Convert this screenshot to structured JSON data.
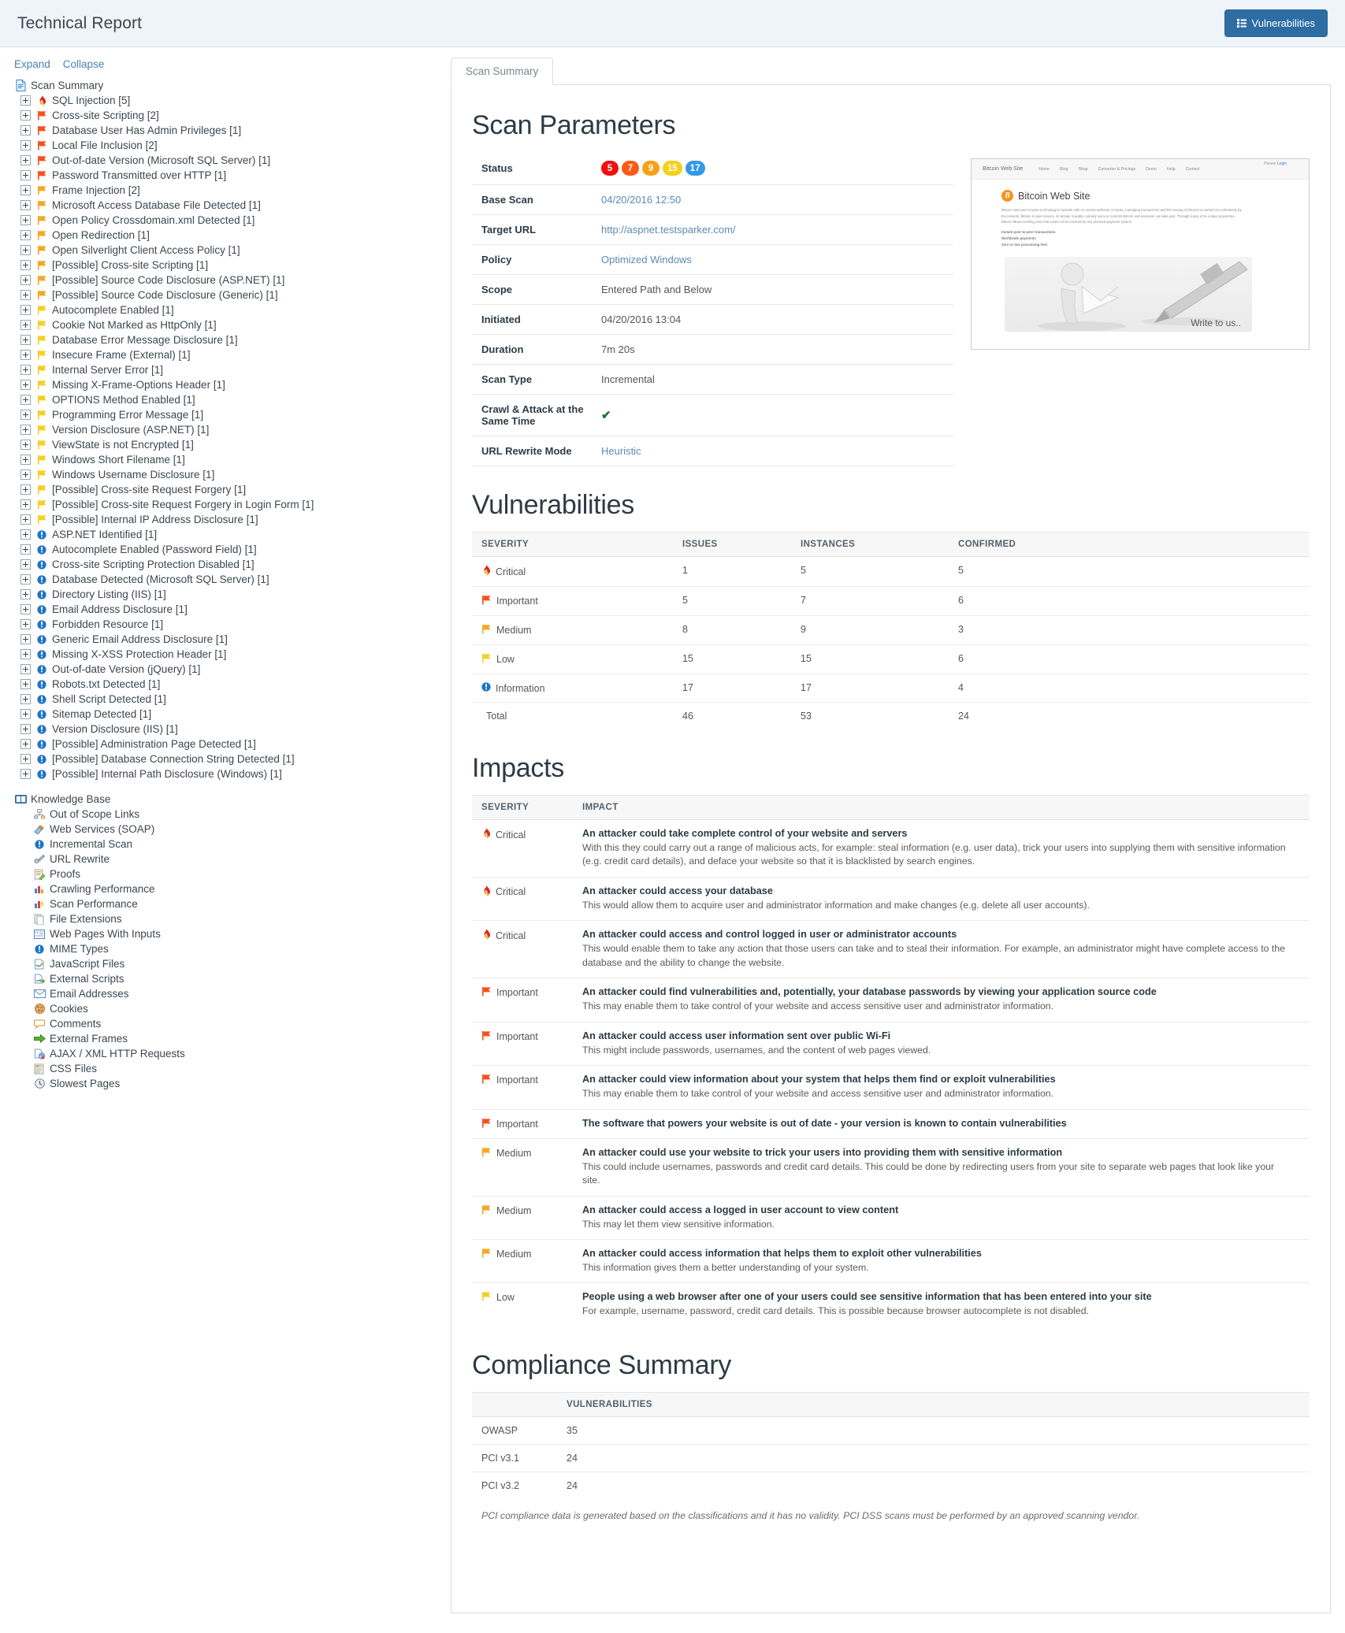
{
  "header": {
    "title": "Technical Report",
    "vulnerabilities_button": "Vulnerabilities"
  },
  "sidebar": {
    "expand_label": "Expand",
    "collapse_label": "Collapse",
    "root_label": "Scan Summary",
    "root_icon": "document-icon",
    "items": [
      {
        "label": "SQL Injection [5]",
        "icon": "fire-icon",
        "sev": "critical"
      },
      {
        "label": "Cross-site Scripting [2]",
        "icon": "flag-icon",
        "sev": "important"
      },
      {
        "label": "Database User Has Admin Privileges [1]",
        "icon": "flag-icon",
        "sev": "important"
      },
      {
        "label": "Local File Inclusion [2]",
        "icon": "flag-icon",
        "sev": "important"
      },
      {
        "label": "Out-of-date Version (Microsoft SQL Server) [1]",
        "icon": "flag-icon",
        "sev": "important"
      },
      {
        "label": "Password Transmitted over HTTP [1]",
        "icon": "flag-icon",
        "sev": "important"
      },
      {
        "label": "Frame Injection [2]",
        "icon": "flag-icon",
        "sev": "medium"
      },
      {
        "label": "Microsoft Access Database File Detected [1]",
        "icon": "flag-icon",
        "sev": "medium"
      },
      {
        "label": "Open Policy Crossdomain.xml Detected [1]",
        "icon": "flag-icon",
        "sev": "medium"
      },
      {
        "label": "Open Redirection [1]",
        "icon": "flag-icon",
        "sev": "medium"
      },
      {
        "label": "Open Silverlight Client Access Policy [1]",
        "icon": "flag-icon",
        "sev": "medium"
      },
      {
        "label": "[Possible] Cross-site Scripting [1]",
        "icon": "flag-icon",
        "sev": "medium"
      },
      {
        "label": "[Possible] Source Code Disclosure (ASP.NET) [1]",
        "icon": "flag-icon",
        "sev": "medium"
      },
      {
        "label": "[Possible] Source Code Disclosure (Generic) [1]",
        "icon": "flag-icon",
        "sev": "medium"
      },
      {
        "label": "Autocomplete Enabled [1]",
        "icon": "flag-icon",
        "sev": "low"
      },
      {
        "label": "Cookie Not Marked as HttpOnly [1]",
        "icon": "flag-icon",
        "sev": "low"
      },
      {
        "label": "Database Error Message Disclosure [1]",
        "icon": "flag-icon",
        "sev": "low"
      },
      {
        "label": "Insecure Frame (External) [1]",
        "icon": "flag-icon",
        "sev": "low"
      },
      {
        "label": "Internal Server Error [1]",
        "icon": "flag-icon",
        "sev": "low"
      },
      {
        "label": "Missing X-Frame-Options Header [1]",
        "icon": "flag-icon",
        "sev": "low"
      },
      {
        "label": "OPTIONS Method Enabled [1]",
        "icon": "flag-icon",
        "sev": "low"
      },
      {
        "label": "Programming Error Message [1]",
        "icon": "flag-icon",
        "sev": "low"
      },
      {
        "label": "Version Disclosure (ASP.NET) [1]",
        "icon": "flag-icon",
        "sev": "low"
      },
      {
        "label": "ViewState is not Encrypted [1]",
        "icon": "flag-icon",
        "sev": "low"
      },
      {
        "label": "Windows Short Filename [1]",
        "icon": "flag-icon",
        "sev": "low"
      },
      {
        "label": "Windows Username Disclosure [1]",
        "icon": "flag-icon",
        "sev": "low"
      },
      {
        "label": "[Possible] Cross-site Request Forgery [1]",
        "icon": "flag-icon",
        "sev": "low"
      },
      {
        "label": "[Possible] Cross-site Request Forgery in Login Form [1]",
        "icon": "flag-icon",
        "sev": "low"
      },
      {
        "label": "[Possible] Internal IP Address Disclosure [1]",
        "icon": "flag-icon",
        "sev": "low"
      },
      {
        "label": "ASP.NET Identified [1]",
        "icon": "info-icon",
        "sev": "info"
      },
      {
        "label": "Autocomplete Enabled (Password Field) [1]",
        "icon": "info-icon",
        "sev": "info"
      },
      {
        "label": "Cross-site Scripting Protection Disabled [1]",
        "icon": "info-icon",
        "sev": "info"
      },
      {
        "label": "Database Detected (Microsoft SQL Server) [1]",
        "icon": "info-icon",
        "sev": "info"
      },
      {
        "label": "Directory Listing (IIS) [1]",
        "icon": "info-icon",
        "sev": "info"
      },
      {
        "label": "Email Address Disclosure [1]",
        "icon": "info-icon",
        "sev": "info"
      },
      {
        "label": "Forbidden Resource [1]",
        "icon": "info-icon",
        "sev": "info"
      },
      {
        "label": "Generic Email Address Disclosure [1]",
        "icon": "info-icon",
        "sev": "info"
      },
      {
        "label": "Missing X-XSS Protection Header [1]",
        "icon": "info-icon",
        "sev": "info"
      },
      {
        "label": "Out-of-date Version (jQuery) [1]",
        "icon": "info-icon",
        "sev": "info"
      },
      {
        "label": "Robots.txt Detected [1]",
        "icon": "info-icon",
        "sev": "info"
      },
      {
        "label": "Shell Script Detected [1]",
        "icon": "info-icon",
        "sev": "info"
      },
      {
        "label": "Sitemap Detected [1]",
        "icon": "info-icon",
        "sev": "info"
      },
      {
        "label": "Version Disclosure (IIS) [1]",
        "icon": "info-icon",
        "sev": "info"
      },
      {
        "label": "[Possible] Administration Page Detected [1]",
        "icon": "info-icon",
        "sev": "info"
      },
      {
        "label": "[Possible] Database Connection String Detected [1]",
        "icon": "info-icon",
        "sev": "info"
      },
      {
        "label": "[Possible] Internal Path Disclosure (Windows) [1]",
        "icon": "info-icon",
        "sev": "info"
      }
    ],
    "knowledge_base": {
      "label": "Knowledge Base",
      "icon": "book-icon",
      "items": [
        {
          "label": "Out of Scope Links",
          "icon": "sitemap-icon"
        },
        {
          "label": "Web Services (SOAP)",
          "icon": "soap-icon"
        },
        {
          "label": "Incremental Scan",
          "icon": "info-icon"
        },
        {
          "label": "URL Rewrite",
          "icon": "rewrite-icon"
        },
        {
          "label": "Proofs",
          "icon": "proof-icon"
        },
        {
          "label": "Crawling Performance",
          "icon": "bar-chart-icon"
        },
        {
          "label": "Scan Performance",
          "icon": "bar-chart-bolt-icon"
        },
        {
          "label": "File Extensions",
          "icon": "files-icon"
        },
        {
          "label": "Web Pages With Inputs",
          "icon": "form-icon"
        },
        {
          "label": "MIME Types",
          "icon": "info-icon"
        },
        {
          "label": "JavaScript Files",
          "icon": "js-file-icon"
        },
        {
          "label": "External Scripts",
          "icon": "external-script-icon"
        },
        {
          "label": "Email Addresses",
          "icon": "envelope-icon"
        },
        {
          "label": "Cookies",
          "icon": "cookie-icon"
        },
        {
          "label": "Comments",
          "icon": "comment-icon"
        },
        {
          "label": "External Frames",
          "icon": "green-arrow-icon"
        },
        {
          "label": "AJAX / XML HTTP Requests",
          "icon": "ajax-icon"
        },
        {
          "label": "CSS Files",
          "icon": "css-file-icon"
        },
        {
          "label": "Slowest Pages",
          "icon": "clock-icon"
        }
      ]
    }
  },
  "main": {
    "tabs": [
      {
        "label": "Scan Summary",
        "active": true
      }
    ],
    "scan_parameters": {
      "heading": "Scan Parameters",
      "status_label": "Status",
      "status_badges": [
        {
          "value": "5",
          "color": "#f20d0d"
        },
        {
          "value": "7",
          "color": "#fa5a14"
        },
        {
          "value": "9",
          "color": "#f8a117"
        },
        {
          "value": "15",
          "color": "#f5cf18"
        },
        {
          "value": "17",
          "color": "#3699e6"
        }
      ],
      "rows": [
        {
          "key": "Base Scan",
          "value": "04/20/2016 12:50",
          "link": true
        },
        {
          "key": "Target URL",
          "value": "http://aspnet.testsparker.com/",
          "link": true
        },
        {
          "key": "Policy",
          "value": "Optimized Windows",
          "link": true
        },
        {
          "key": "Scope",
          "value": "Entered Path and Below",
          "link": false
        },
        {
          "key": "Initiated",
          "value": "04/20/2016 13:04",
          "link": false
        },
        {
          "key": "Duration",
          "value": "7m 20s",
          "link": false
        },
        {
          "key": "Scan Type",
          "value": "Incremental",
          "link": false
        },
        {
          "key": "Crawl & Attack at the Same Time",
          "value": "✔",
          "link": false,
          "check": true
        },
        {
          "key": "URL Rewrite Mode",
          "value": "Heuristic",
          "link": true
        }
      ]
    },
    "thumbnail": {
      "name": "site-thumbnail",
      "please_text": "Please",
      "login_text": "Login",
      "brand": "Bitcoin Web Site",
      "nav": [
        "Home",
        "Blog",
        "Shop",
        "Converter & Pricings",
        "Demo",
        "Help",
        "Contact"
      ],
      "coin_letter": "B",
      "title": "Bitcoin Web Site",
      "paragraph": "Bitcoin uses peer-to-peer technology to operate with no central authority or banks; managing transactions and the issuing of bitcoins is carried out collectively by the network. Bitcoin is open-source, its design is public, nobody owns or controls Bitcoin and everyone can take part. Through many of its unique properties, Bitcoin allows exciting uses that could not be covered by any previous payment system.",
      "bullets": [
        "Instant peer-to-peer transactions",
        "Worldwide payments",
        "Zero or low processing fees"
      ],
      "image_caption": "Write to us.."
    },
    "vulnerabilities": {
      "heading": "Vulnerabilities",
      "columns": [
        "SEVERITY",
        "ISSUES",
        "INSTANCES",
        "CONFIRMED"
      ],
      "rows": [
        {
          "severity": "Critical",
          "icon": "fire-icon",
          "sev": "critical",
          "issues": "1",
          "instances": "5",
          "confirmed": "5"
        },
        {
          "severity": "Important",
          "icon": "flag-icon",
          "sev": "important",
          "issues": "5",
          "instances": "7",
          "confirmed": "6"
        },
        {
          "severity": "Medium",
          "icon": "flag-icon",
          "sev": "medium",
          "issues": "8",
          "instances": "9",
          "confirmed": "3"
        },
        {
          "severity": "Low",
          "icon": "flag-icon",
          "sev": "low",
          "issues": "15",
          "instances": "15",
          "confirmed": "6"
        },
        {
          "severity": "Information",
          "icon": "info-icon",
          "sev": "info",
          "issues": "17",
          "instances": "17",
          "confirmed": "4"
        },
        {
          "severity": "Total",
          "icon": "none",
          "sev": "none",
          "issues": "46",
          "instances": "53",
          "confirmed": "24"
        }
      ]
    },
    "impacts": {
      "heading": "Impacts",
      "columns": [
        "SEVERITY",
        "IMPACT"
      ],
      "rows": [
        {
          "severity": "Critical",
          "icon": "fire-icon",
          "sev": "critical",
          "title": "An attacker could take complete control of your website and servers",
          "desc": "With this they could carry out a range of malicious acts, for example: steal information (e.g. user data), trick your users into supplying them with sensitive information (e.g. credit card details), and deface your website so that it is blacklisted by search engines."
        },
        {
          "severity": "Critical",
          "icon": "fire-icon",
          "sev": "critical",
          "title": "An attacker could access your database",
          "desc": "This would allow them to acquire user and administrator information and make changes (e.g. delete all user accounts)."
        },
        {
          "severity": "Critical",
          "icon": "fire-icon",
          "sev": "critical",
          "title": "An attacker could access and control logged in user or administrator accounts",
          "desc": "This would enable them to take any action that those users can take and to steal their information. For example, an administrator might have complete access to the database and the ability to change the website."
        },
        {
          "severity": "Important",
          "icon": "flag-icon",
          "sev": "important",
          "title": "An attacker could find vulnerabilities and, potentially, your database passwords by viewing your application source code",
          "desc": "This may enable them to take control of your website and access sensitive user and administrator information."
        },
        {
          "severity": "Important",
          "icon": "flag-icon",
          "sev": "important",
          "title": "An attacker could access user information sent over public Wi-Fi",
          "desc": "This might include passwords, usernames, and the content of web pages viewed."
        },
        {
          "severity": "Important",
          "icon": "flag-icon",
          "sev": "important",
          "title": "An attacker could view information about your system that helps them find or exploit vulnerabilities",
          "desc": "This may enable them to take control of your website and access sensitive user and administrator information."
        },
        {
          "severity": "Important",
          "icon": "flag-icon",
          "sev": "important",
          "title": "The software that powers your website is out of date - your version is known to contain vulnerabilities",
          "desc": ""
        },
        {
          "severity": "Medium",
          "icon": "flag-icon",
          "sev": "medium",
          "title": "An attacker could use your website to trick your users into providing them with sensitive information",
          "desc": "This could include usernames, passwords and credit card details. This could be done by redirecting users from your site to separate web pages that look like your site."
        },
        {
          "severity": "Medium",
          "icon": "flag-icon",
          "sev": "medium",
          "title": "An attacker could access a logged in user account to view content",
          "desc": "This may let them view sensitive information."
        },
        {
          "severity": "Medium",
          "icon": "flag-icon",
          "sev": "medium",
          "title": "An attacker could access information that helps them to exploit other vulnerabilities",
          "desc": "This information gives them a better understanding of your system."
        },
        {
          "severity": "Low",
          "icon": "flag-icon",
          "sev": "low",
          "title": "People using a web browser after one of your users could see sensitive information that has been entered into your site",
          "desc": "For example, username, password, credit card details. This is possible because browser autocomplete is not disabled."
        }
      ]
    },
    "compliance": {
      "heading": "Compliance Summary",
      "columns": [
        "",
        "VULNERABILITIES"
      ],
      "rows": [
        {
          "name": "OWASP",
          "value": "35"
        },
        {
          "name": "PCI v3.1",
          "value": "24"
        },
        {
          "name": "PCI v3.2",
          "value": "24"
        }
      ],
      "note": "PCI compliance data is generated based on the classifications and it has no validity. PCI DSS scans must be performed by an approved scanning vendor."
    }
  },
  "colors": {
    "critical": "#e02020",
    "important": "#f4511e",
    "medium": "#f5a623",
    "low": "#f2d023",
    "info": "#2f86d6",
    "accent": "#2e6da4"
  }
}
